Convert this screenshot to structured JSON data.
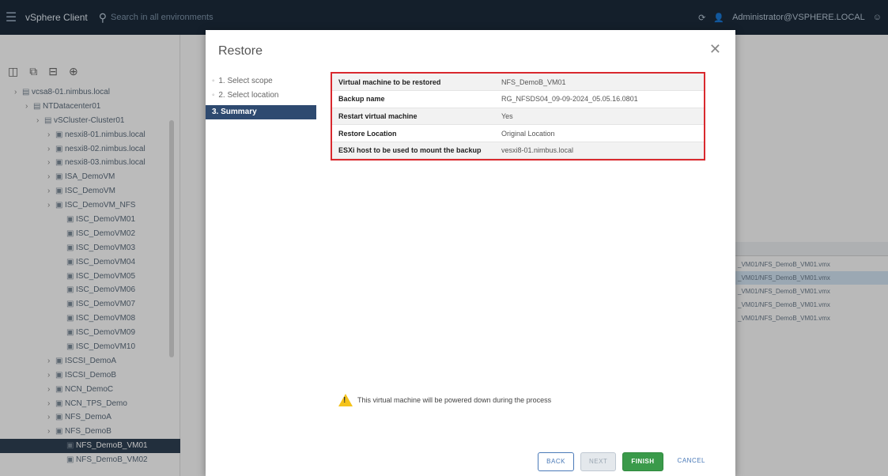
{
  "topbar": {
    "brand": "vSphere Client",
    "search_placeholder": "Search in all environments",
    "user": "Administrator@VSPHERE.LOCAL"
  },
  "tree": {
    "items": [
      {
        "label": "vcsa8-01.nimbus.local",
        "depth": 0
      },
      {
        "label": "NTDatacenter01",
        "depth": 1
      },
      {
        "label": "vSCluster-Cluster01",
        "depth": 2
      },
      {
        "label": "nesxi8-01.nimbus.local",
        "depth": 3
      },
      {
        "label": "nesxi8-02.nimbus.local",
        "depth": 3
      },
      {
        "label": "nesxi8-03.nimbus.local",
        "depth": 3
      },
      {
        "label": "ISA_DemoVM",
        "depth": 3
      },
      {
        "label": "ISC_DemoVM",
        "depth": 3
      },
      {
        "label": "ISC_DemoVM_NFS",
        "depth": 3
      },
      {
        "label": "ISC_DemoVM01",
        "depth": 4
      },
      {
        "label": "ISC_DemoVM02",
        "depth": 4
      },
      {
        "label": "ISC_DemoVM03",
        "depth": 4
      },
      {
        "label": "ISC_DemoVM04",
        "depth": 4
      },
      {
        "label": "ISC_DemoVM05",
        "depth": 4
      },
      {
        "label": "ISC_DemoVM06",
        "depth": 4
      },
      {
        "label": "ISC_DemoVM07",
        "depth": 4
      },
      {
        "label": "ISC_DemoVM08",
        "depth": 4
      },
      {
        "label": "ISC_DemoVM09",
        "depth": 4
      },
      {
        "label": "ISC_DemoVM10",
        "depth": 4
      },
      {
        "label": "ISCSI_DemoA",
        "depth": 3
      },
      {
        "label": "ISCSI_DemoB",
        "depth": 3
      },
      {
        "label": "NCN_DemoC",
        "depth": 3
      },
      {
        "label": "NCN_TPS_Demo",
        "depth": 3
      },
      {
        "label": "NFS_DemoA",
        "depth": 3
      },
      {
        "label": "NFS_DemoB",
        "depth": 3
      },
      {
        "label": "NFS_DemoB_VM01",
        "depth": 4,
        "selected": true
      },
      {
        "label": "NFS_DemoB_VM02",
        "depth": 4
      }
    ]
  },
  "background_list": {
    "rows": [
      {
        "label": "_VM01/NFS_DemoB_VM01.vmx",
        "selected": false
      },
      {
        "label": "_VM01/NFS_DemoB_VM01.vmx",
        "selected": true
      },
      {
        "label": "_VM01/NFS_DemoB_VM01.vmx",
        "selected": false
      },
      {
        "label": "_VM01/NFS_DemoB_VM01.vmx",
        "selected": false
      },
      {
        "label": "_VM01/NFS_DemoB_VM01.vmx",
        "selected": false
      }
    ]
  },
  "modal": {
    "title": "Restore",
    "steps": [
      {
        "label": "1. Select scope"
      },
      {
        "label": "2. Select location"
      },
      {
        "label": "3. Summary",
        "active": true
      }
    ],
    "summary_rows": [
      {
        "key": "Virtual machine to be restored",
        "value": "NFS_DemoB_VM01"
      },
      {
        "key": "Backup name",
        "value": "RG_NFSDS04_09-09-2024_05.05.16.0801"
      },
      {
        "key": "Restart virtual machine",
        "value": "Yes"
      },
      {
        "key": "Restore Location",
        "value": "Original Location"
      },
      {
        "key": "ESXi host to be used to mount the backup",
        "value": "vesxi8-01.nimbus.local"
      }
    ],
    "warning": "This virtual machine will be powered down during the process",
    "buttons": {
      "back": "BACK",
      "next": "NEXT",
      "finish": "FINISH",
      "cancel": "CANCEL"
    }
  }
}
